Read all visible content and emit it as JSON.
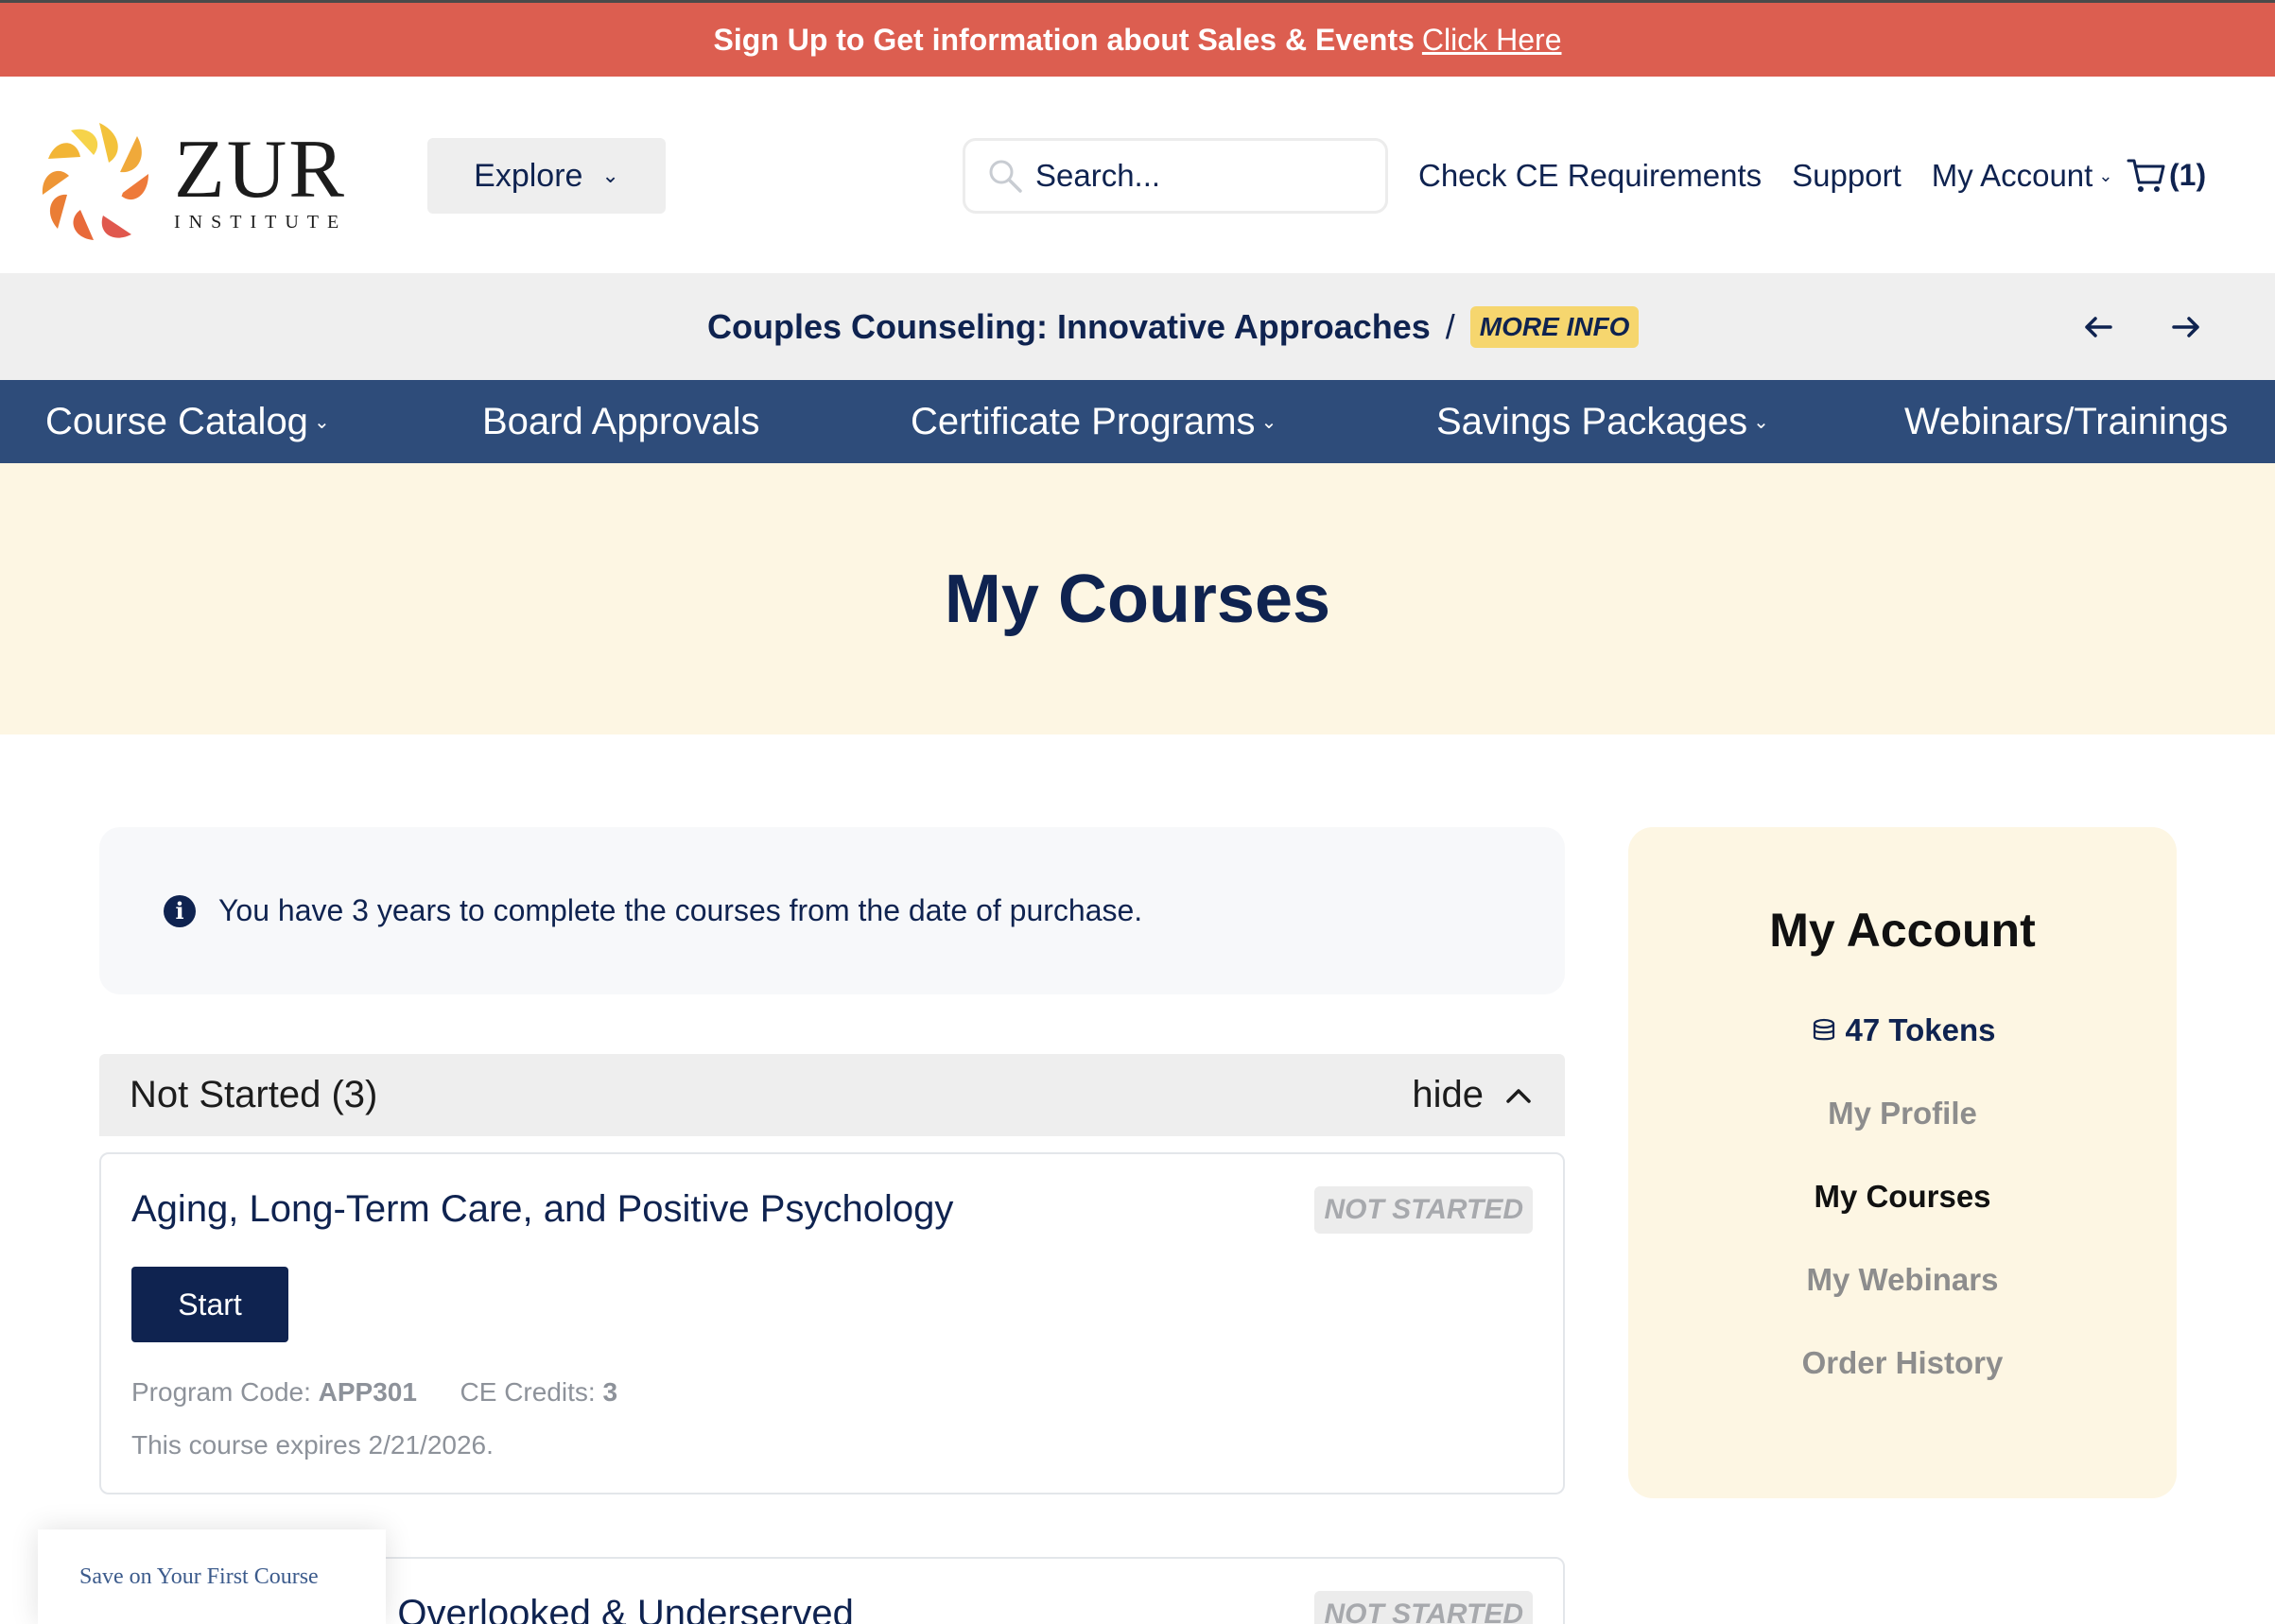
{
  "promo_banner": {
    "text": "Sign Up to Get information about Sales & Events",
    "link": "Click Here"
  },
  "logo": {
    "name": "ZUR",
    "subtitle": "INSTITUTE"
  },
  "header": {
    "explore_label": "Explore",
    "search_placeholder": "Search...",
    "links": {
      "ce_requirements": "Check CE Requirements",
      "support": "Support",
      "my_account": "My Account"
    },
    "cart_count": "(1)"
  },
  "promo_strip": {
    "title": "Couples Counseling: Innovative Approaches",
    "separator": "/",
    "more_info": "MORE INFO"
  },
  "nav": {
    "items": [
      {
        "label": "Course Catalog",
        "has_dropdown": true
      },
      {
        "label": "Board Approvals",
        "has_dropdown": false
      },
      {
        "label": "Certificate Programs",
        "has_dropdown": true
      },
      {
        "label": "Savings Packages",
        "has_dropdown": true
      },
      {
        "label": "Webinars/Trainings",
        "has_dropdown": false
      }
    ]
  },
  "hero": {
    "title": "My Courses"
  },
  "info": {
    "text": "You have 3 years to complete the courses from the date of purchase."
  },
  "section": {
    "title": "Not Started (3)",
    "toggle": "hide"
  },
  "courses": [
    {
      "title": "Aging, Long-Term Care, and Positive Psychology",
      "status": "NOT STARTED",
      "button": "Start",
      "program_code_label": "Program Code:",
      "program_code": "APP301",
      "ce_credits_label": "CE Credits:",
      "ce_credits": "3",
      "expires": "This course expires 2/21/2026."
    },
    {
      "title": "les: Overlooked & Underserved",
      "status": "NOT STARTED"
    }
  ],
  "sidebar": {
    "title": "My Account",
    "tokens": "47 Tokens",
    "links": {
      "profile": "My Profile",
      "courses": "My Courses",
      "webinars": "My Webinars",
      "orders": "Order History"
    }
  },
  "save_widget": {
    "text": "Save on Your First Course"
  },
  "colors": {
    "banner": "#dc5e50",
    "navy": "#0f2350",
    "nav_bar": "#2e4c7a",
    "cream": "#fdf6e3",
    "badge_yellow": "#f6d66e"
  }
}
